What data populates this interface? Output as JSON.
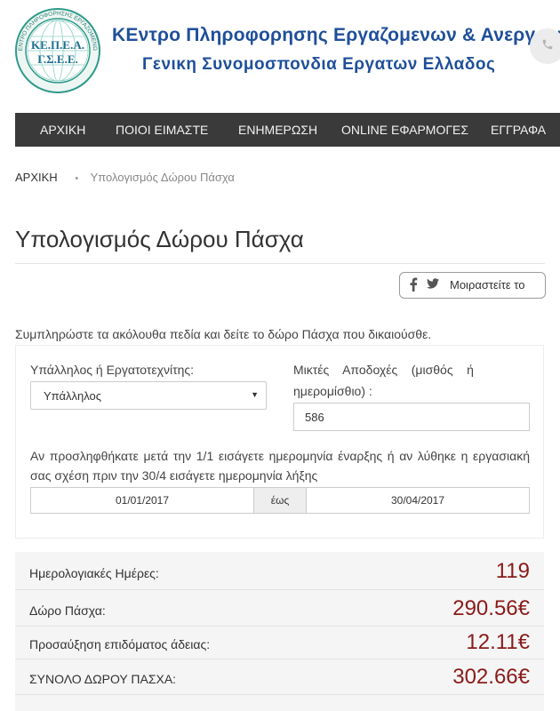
{
  "header": {
    "logo_text_top": "ΚΕ.Π.Ε.Α.",
    "logo_text_bottom": "Γ.Σ.Ε.Ε.",
    "logo_ring_text": "ΚΕΝΤΡΟ ΠΛΗΡΟΦΟΡΗΣΗΣ ΕΡΓΑΖΟΜΕΝΩΝ",
    "title_line1": "ΚΕντρο Πληροφορησης Εργαζομενων & Ανεργων",
    "title_line2": "Γενικη Συνομοσπονδια Εργατων Ελλαδος",
    "phone_icon": "phone-icon"
  },
  "nav": {
    "items": [
      "ΑΡΧΙΚΗ",
      "ΠΟΙΟΙ ΕΙΜΑΣΤΕ",
      "ΕΝΗΜΕΡΩΣΗ",
      "ONLINE ΕΦΑΡΜΟΓΕΣ",
      "ΕΓΓΡΑΦΑ"
    ]
  },
  "breadcrumb": {
    "home": "ΑΡΧΙΚΗ",
    "separator": "•",
    "current": "Υπολογισμός Δώρου Πάσχα"
  },
  "page": {
    "title": "Υπολογισμός Δώρου Πάσχα",
    "share_label": "Μοιραστείτε το",
    "intro": "Συμπληρώστε τα ακόλουθα πεδία και δείτε το δώρο Πάσχα που δικαιούσθε."
  },
  "form": {
    "employee_type_label": "Υπάλληλος ή Εργατοτεχνίτης:",
    "employee_type_value": "Υπάλληλος",
    "wage_label_line1": "Μικτές    Αποδοχές    (μισθός    ή",
    "wage_label_line2": "ημερομίσθιο) :",
    "wage_value": "586",
    "dates_note": "Αν προσληφθήκατε μετά την 1/1 εισάγετε ημερομηνία έναρξης ή αν λύθηκε η εργασιακή σας σχέση πριν την 30/4 εισάγετε ημερομηνία λήξης",
    "date_from": "01/01/2017",
    "date_separator": "έως",
    "date_to": "30/04/2017"
  },
  "results": [
    {
      "label": "Ημερολογιακές Ημέρες:",
      "value": "119"
    },
    {
      "label": "Δώρο Πάσχα:",
      "value": "290.56€"
    },
    {
      "label": "Προσαύξηση επιδόματος άδειας:",
      "value": "12.11€"
    },
    {
      "label": "ΣΥΝΟΛΟ ΔΩΡΟΥ ΠΑΣΧΑ:",
      "value": "302.66€"
    }
  ],
  "colors": {
    "brand_blue": "#1f4f9a",
    "nav_bg": "#3a3a3a",
    "result_value": "#8b1a1a"
  }
}
